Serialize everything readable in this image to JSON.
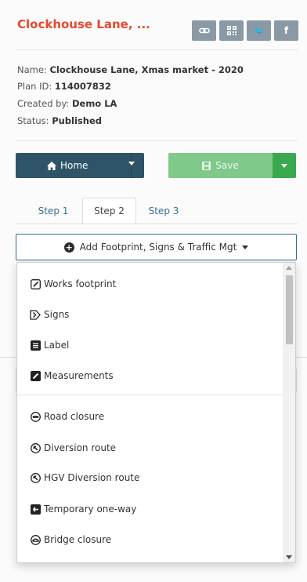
{
  "plan": {
    "title": "Clockhouse Lane, ...",
    "name_label": "Name:",
    "name_value": "Clockhouse Lane, Xmas market - 2020",
    "plan_id_label": "Plan ID:",
    "plan_id_value": "114007832",
    "created_label": "Created by:",
    "created_value": "Demo LA",
    "status_label": "Status:",
    "status_value": "Published"
  },
  "share_icons": [
    "link-icon",
    "qr-code-icon",
    "twitter-icon",
    "facebook-icon"
  ],
  "share_glyphs": {
    "twitter": "🐦",
    "facebook": "f"
  },
  "buttons": {
    "home": "Home",
    "save": "Save"
  },
  "tabs": [
    {
      "label": "Step 1",
      "active": false
    },
    {
      "label": "Step 2",
      "active": true
    },
    {
      "label": "Step 3",
      "active": false
    }
  ],
  "add_menu": {
    "toggle_label": "Add Footprint, Signs & Traffic Mgt",
    "items": [
      {
        "label": "Works footprint",
        "icon": "works-footprint-icon"
      },
      {
        "label": "Signs",
        "icon": "signs-icon"
      },
      {
        "label": "Label",
        "icon": "label-icon"
      },
      {
        "label": "Measurements",
        "icon": "measurements-icon"
      },
      {
        "label": "Road closure",
        "icon": "road-closure-icon"
      },
      {
        "label": "Diversion route",
        "icon": "diversion-route-icon"
      },
      {
        "label": "HGV Diversion route",
        "icon": "hgv-diversion-icon"
      },
      {
        "label": "Temporary one-way",
        "icon": "one-way-icon"
      },
      {
        "label": "Bridge closure",
        "icon": "bridge-closure-icon"
      }
    ]
  },
  "colors": {
    "title": "#e44a2f",
    "home_button": "#2f5467",
    "save_button": "#7fc98a",
    "save_dropdown": "#3aa84f",
    "social_button": "#8a99a6",
    "toggle_border": "#2f6f8f"
  }
}
